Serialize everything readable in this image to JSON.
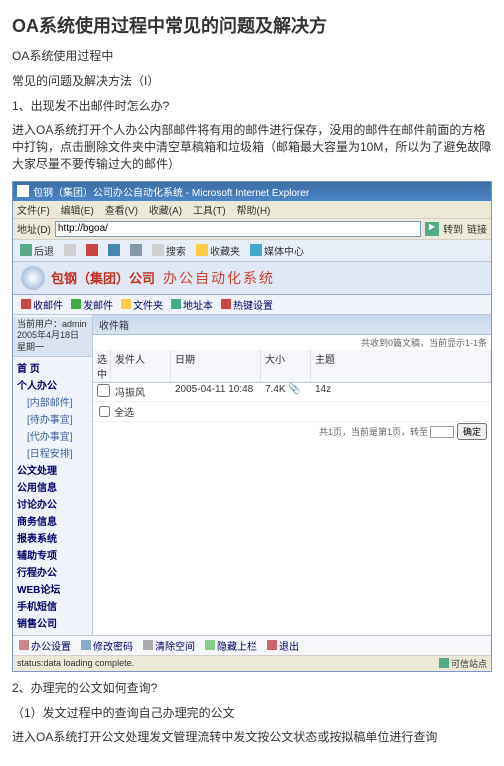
{
  "title": "OA系统使用过程中常见的问题及解决方",
  "intro1": "OA系统使用过程中",
  "intro2": "常见的问题及解决方法（I）",
  "q1": "1、出现发不出邮件时怎么办?",
  "q1_desc": "进入OA系统打开个人办公内部邮件将有用的邮件进行保存，没用的邮件在邮件前面的方格中打钩，点击删除文件夹中清空草稿箱和垃圾箱（邮箱最大容量为10M，所以为了避免故障大家尽量不要传输过大的邮件）",
  "ie": {
    "title": "包钢（集团）公司办公自动化系统 - Microsoft Internet Explorer",
    "menu": {
      "file": "文件(F)",
      "edit": "编辑(E)",
      "view": "查看(V)",
      "fav": "收藏(A)",
      "tools": "工具(T)",
      "help": "帮助(H)"
    },
    "addr_label": "地址(D)",
    "addr_value": "http://bgoa/",
    "go": "转到",
    "links": "链接",
    "tb": {
      "back": "后退",
      "search": "搜索",
      "fav": "收藏夹",
      "media": "媒体中心"
    }
  },
  "banner": {
    "company": "包钢（集团）公司",
    "system": "办公自动化系统"
  },
  "nav": {
    "rcv": "收邮件",
    "send": "发邮件",
    "fold": "文件夹",
    "addr": "地址本",
    "hot": "热键设置"
  },
  "user": {
    "label": "当前用户：admin",
    "date": "2005年4月18日 星期一"
  },
  "tree": {
    "home": "首 页",
    "personal": "个人办公",
    "inbox": "[内部邮件]",
    "todo": "[待办事宜]",
    "done": "[代办事宜]",
    "calendar": "[日程安排]",
    "docmgr": "公文处理",
    "pubinfo": "公用信息",
    "luntan": "讨论办公",
    "business": "商务信息",
    "report": "报表系统",
    "assist": "辅助专项",
    "walk": "行程办公",
    "forum": "WEB论坛",
    "sms": "手机短信",
    "sale": "销售公司"
  },
  "mailbox": {
    "header": "收件箱",
    "sub": "共收到0篇文稿，当前显示1-1条",
    "cols": {
      "chk": "选中",
      "sender": "发件人",
      "date": "日期",
      "size": "大小",
      "subject": "主题"
    },
    "row": {
      "sender": "冯振风",
      "date": "2005-04-11 10:48",
      "size": "7.4K 📎",
      "subject": "14z"
    },
    "allchk": "全选",
    "paginate": "共1页，当前是第1页，转至",
    "page_btn": "确定"
  },
  "bottom": {
    "set": "办公设置",
    "pwd": "修改密码",
    "clear": "清除空间",
    "hide": "隐藏上栏",
    "exit": "退出"
  },
  "status": {
    "text": "status:data loading complete.",
    "zone": "可信站点"
  },
  "q2": "2、办理完的公文如何查询?",
  "q2_sub": "（1）发文过程中的查询自己办理完的公文",
  "q2_desc": "进入OA系统打开公文处理发文管理流转中发文按公文状态或按拟稿单位进行查询"
}
